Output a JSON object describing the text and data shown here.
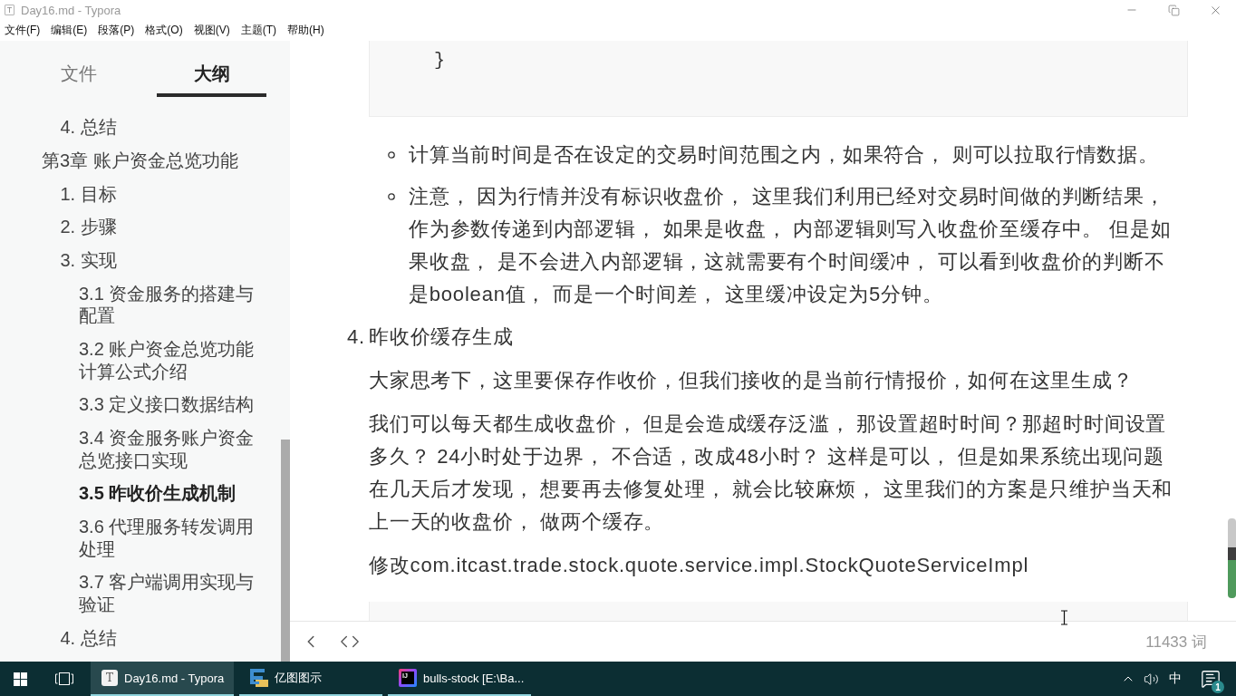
{
  "window": {
    "icon_text": "T",
    "title": "Day16.md - Typora"
  },
  "menu": [
    "文件(F)",
    "编辑(E)",
    "段落(P)",
    "格式(O)",
    "视图(V)",
    "主题(T)",
    "帮助(H)"
  ],
  "sidebar": {
    "tabs": [
      {
        "label": "文件",
        "selected": false
      },
      {
        "label": "大纲",
        "selected": true
      }
    ],
    "outline": [
      {
        "children": [
          {
            "label": "4. 总结",
            "selected": false
          }
        ]
      },
      {
        "label": "第3章 账户资金总览功能",
        "selected": false,
        "children": [
          {
            "label": "1. 目标",
            "selected": false
          },
          {
            "label": "2. 步骤",
            "selected": false
          },
          {
            "label": "3. 实现",
            "selected": false,
            "children": [
              {
                "label": "3.1 资金服务的搭建与配置",
                "selected": false
              },
              {
                "label": "3.2 账户资金总览功能计算公式介绍",
                "selected": false
              },
              {
                "label": "3.3 定义接口数据结构",
                "selected": false
              },
              {
                "label": "3.4 资金服务账户资金总览接口实现",
                "selected": false
              },
              {
                "label": "3.5 昨收价生成机制",
                "selected": true
              },
              {
                "label": "3.6 代理服务转发调用处理",
                "selected": false
              },
              {
                "label": "3.7 客户端调用实现与验证",
                "selected": false
              }
            ]
          },
          {
            "label": "4. 总结",
            "selected": false
          }
        ]
      }
    ]
  },
  "editor": {
    "blocks": [
      {
        "kind": "code",
        "lines": [
          "}"
        ]
      },
      {
        "kind": "bullet",
        "text": "计算当前时间是否在设定的交易时间范围之内，如果符合， 则可以拉取行情数据。"
      },
      {
        "kind": "bullet",
        "text": "注意， 因为行情并没有标识收盘价， 这里我们利用已经对交易时间做的判断结果，作为参数传递到内部逻辑， 如果是收盘， 内部逻辑则写入收盘价至缓存中。 但是如果收盘， 是不会进入内部逻辑，这就需要有个时间缓冲， 可以看到收盘价的判断不是boolean值， 而是一个时间差， 这里缓冲设定为5分钟。"
      },
      {
        "kind": "numbered",
        "marker": "4.",
        "text": "昨收价缓存生成"
      },
      {
        "kind": "paragraph",
        "text": "大家思考下，这里要保存作收价，但我们接收的是当前行情报价，如何在这里生成？"
      },
      {
        "kind": "paragraph",
        "text": "我们可以每天都生成收盘价， 但是会造成缓存泛滥， 那设置超时时间？那超时时间设置多久？ 24小时处于边界， 不合适，改成48小时？ 这样是可以， 但是如果系统出现问题在几天后才发现， 想要再去修复处理， 就会比较麻烦， 这里我们的方案是只维护当天和上一天的收盘价， 做两个缓存。"
      },
      {
        "kind": "paragraph",
        "text": "修改com.itcast.trade.stock.quote.service.impl.StockQuoteServiceImpl"
      },
      {
        "kind": "code"
      }
    ]
  },
  "footer": {
    "word_count": "11433 词"
  },
  "taskbar": {
    "tasks": [
      {
        "kind": "letter",
        "icon_text": "T",
        "title": "Day16.md - Typora",
        "selected": true
      },
      {
        "kind": "diagram",
        "title": "亿图图示",
        "selected": false
      },
      {
        "kind": "ide",
        "icon_text": "IJ",
        "title": "bulls-stock [E:\\Ba...",
        "selected": false
      }
    ],
    "tray": {
      "ime": "中",
      "notification_count": "1"
    }
  }
}
